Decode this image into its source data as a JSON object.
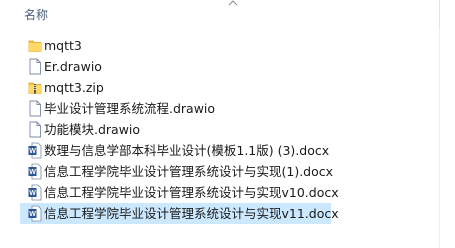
{
  "header": {
    "name_column": "名称"
  },
  "files": [
    {
      "name": "mqtt3",
      "type": "folder",
      "icon": "folder-icon"
    },
    {
      "name": "Er.drawio",
      "type": "file",
      "icon": "file-icon"
    },
    {
      "name": "mqtt3.zip",
      "type": "zip",
      "icon": "zip-folder-icon"
    },
    {
      "name": "毕业设计管理系统流程.drawio",
      "type": "file",
      "icon": "file-icon"
    },
    {
      "name": "功能模块.drawio",
      "type": "file",
      "icon": "file-icon"
    },
    {
      "name": "数理与信息学部本科毕业设计(模板1.1版) (3).docx",
      "type": "word",
      "icon": "word-doc-icon"
    },
    {
      "name": "信息工程学院毕业设计管理系统设计与实现(1).docx",
      "type": "word",
      "icon": "word-doc-icon"
    },
    {
      "name": "信息工程学院毕业设计管理系统设计与实现v10.docx",
      "type": "word",
      "icon": "word-doc-icon"
    },
    {
      "name": "信息工程学院毕业设计管理系统设计与实现v11.docx",
      "type": "word",
      "icon": "word-doc-icon",
      "selected": true
    }
  ],
  "colors": {
    "folder": "#f5c242",
    "selection": "#cce8ff",
    "word_blue": "#2b5797",
    "header_text": "#4c607a"
  }
}
